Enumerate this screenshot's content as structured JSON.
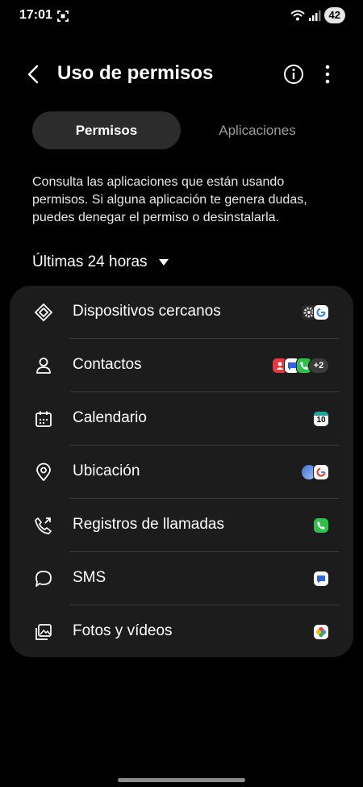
{
  "status_bar": {
    "time": "17:01",
    "battery": "42"
  },
  "header": {
    "title": "Uso de permisos"
  },
  "tabs": [
    {
      "label": "Permisos"
    },
    {
      "label": "Aplicaciones"
    }
  ],
  "description": "Consulta las aplicaciones que están usando permisos. Si alguna aplicación te genera dudas, puedes denegar el permiso o desinstalarla.",
  "period": {
    "label": "Últimas 24 horas"
  },
  "permissions": [
    {
      "label": "Dispositivos cercanos",
      "icon": "nearby-devices-icon"
    },
    {
      "label": "Contactos",
      "icon": "person-icon",
      "more_count": "+2"
    },
    {
      "label": "Calendario",
      "icon": "calendar-icon",
      "calendar_badge": "10"
    },
    {
      "label": "Ubicación",
      "icon": "location-pin-icon"
    },
    {
      "label": "Registros de llamadas",
      "icon": "call-log-icon"
    },
    {
      "label": "SMS",
      "icon": "chat-bubble-icon"
    },
    {
      "label": "Fotos y vídeos",
      "icon": "photos-icon"
    }
  ],
  "colors": {
    "background": "#000000",
    "card": "#1c1c1c",
    "tab_active": "#2c2c2c",
    "divider": "#3a3a3a",
    "phone_green": "#2fbf4a",
    "contacts_red": "#e8383d",
    "messages_blue": "#2e63e8"
  }
}
